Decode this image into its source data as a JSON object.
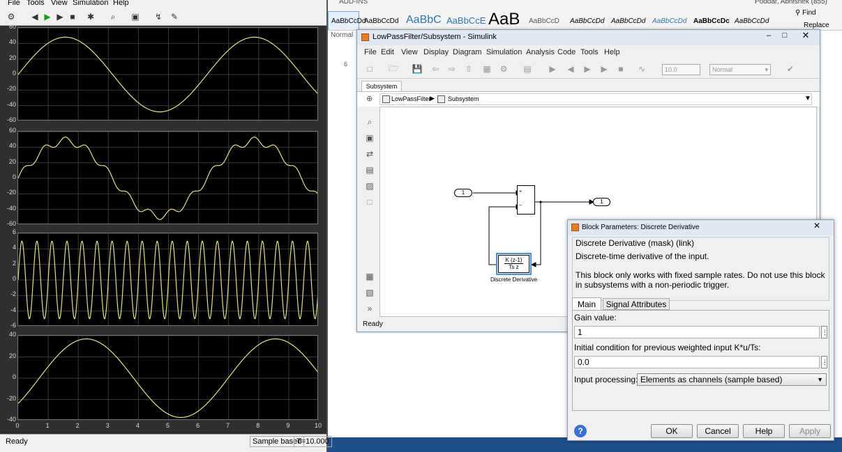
{
  "word": {
    "ribbon_tab": "ADD-INS",
    "user": "Poddar, Abhishek (855)",
    "styles": [
      "AaBbCcDd",
      "AaBbCcDd",
      "AaBbC",
      "AaBbCcE",
      "AaB",
      "AaBbCcD",
      "AaBbCcDd",
      "AaBbCcDd",
      "AaBbCcDd",
      "AaBbCcDc",
      "AaBbCcDd"
    ],
    "style_normal": "Normal",
    "find": "Find",
    "replace": "Replace",
    "ruler_value": "6"
  },
  "scope": {
    "menu": [
      "File",
      "Tools",
      "View",
      "Simulation",
      "Help"
    ],
    "status_ready": "Ready",
    "status_sample": "Sample based",
    "status_time": "T=10.000",
    "y_ticks": [
      [
        "60",
        "40",
        "20",
        "0",
        "-20",
        "-40",
        "-60"
      ],
      [
        "60",
        "40",
        "20",
        "0",
        "-20",
        "-40",
        "-60"
      ],
      [
        "6",
        "4",
        "2",
        "0",
        "-2",
        "-4",
        "-6"
      ],
      [
        "40",
        "20",
        "0",
        "-20",
        "-40"
      ]
    ],
    "x_ticks": [
      "0",
      "1",
      "2",
      "3",
      "4",
      "5",
      "6",
      "7",
      "8",
      "9",
      "10"
    ],
    "line_color": "#e6e080"
  },
  "simulink": {
    "title": "LowPassFilter/Subsystem - Simulink",
    "menu": [
      "File",
      "Edit",
      "View",
      "Display",
      "Diagram",
      "Simulation",
      "Analysis",
      "Code",
      "Tools",
      "Help"
    ],
    "stop_time": "10.0",
    "sim_mode": "Normal",
    "tab": "Subsystem",
    "breadcrumb_root": "LowPassFilter",
    "breadcrumb_child": "Subsystem",
    "inport_label": "1",
    "outport_label": "1",
    "sum_plus": "+",
    "sum_minus": "−",
    "deriv_num": "K (z-1)",
    "deriv_den": "Ts z",
    "deriv_name": "Discrete Derivative",
    "status": "Ready"
  },
  "dialog": {
    "title": "Block Parameters: Discrete Derivative",
    "heading": "Discrete Derivative (mask) (link)",
    "description": "Discrete-time derivative of the input.",
    "note": "This block only works with fixed sample rates. Do not use this block in subsystems with a non-periodic trigger.",
    "tab_main": "Main",
    "tab_signal": "Signal Attributes",
    "gain_label": "Gain value:",
    "gain_value": "1",
    "ic_label": "Initial condition for previous weighted input K*u/Ts:",
    "ic_value": "0.0",
    "processing_label": "Input processing:",
    "processing_value": "Elements as channels (sample based)",
    "ok": "OK",
    "cancel": "Cancel",
    "help": "Help",
    "apply": "Apply"
  }
}
